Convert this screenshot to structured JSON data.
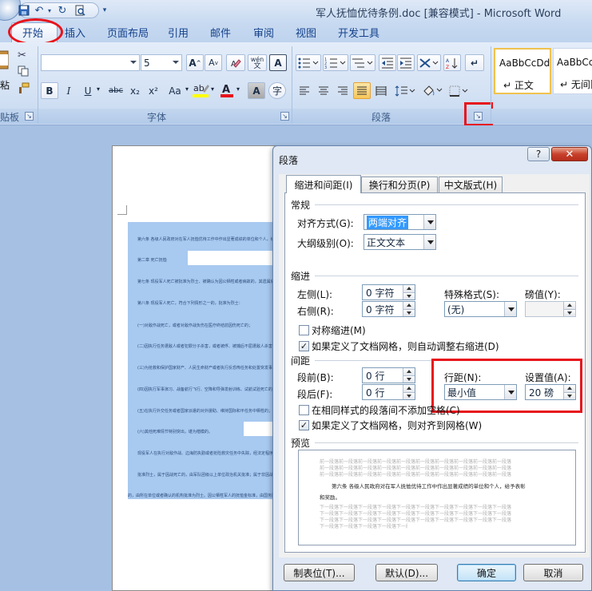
{
  "window": {
    "title": "军人抚恤优待条例.doc [兼容模式] - Microsoft Word"
  },
  "ribbon_tabs": [
    "开始",
    "插入",
    "页面布局",
    "引用",
    "邮件",
    "审阅",
    "视图",
    "开发工具"
  ],
  "ribbon": {
    "clipboard": {
      "label": "贴板",
      "paste_partial": "粘"
    },
    "font": {
      "label": "字体",
      "font_name": "",
      "font_size": "5",
      "buttons": {
        "bold": "B",
        "italic": "I",
        "underline": "U",
        "strike": "abc",
        "subscript": "x₂",
        "superscript": "x²",
        "change_case": "Aa",
        "grow": "A",
        "shrink": "A",
        "phonetic": "wén",
        "char_border": "A",
        "char_shade": "A",
        "enclose": "字"
      }
    },
    "paragraph": {
      "label": "段落"
    },
    "styles": {
      "style1": {
        "sample": "AaBbCcDd",
        "name": "↵ 正文"
      },
      "style2": {
        "sample": "AaBbCc",
        "name": "↵ 无间隔"
      }
    }
  },
  "document": {
    "lines": [
      "第六条  各级人民政府对在军人抚恤优待工作中作出显著成绩的单位和个人，给予表彰和奖励。",
      "第二章  死亡抚恤",
      "第七条  现役军人死亡被批准为烈士、被确认为因公牺牲或者病故的，其遗属依照本条例的规定享受抚恤。",
      "第八条  现役军人死亡，符合下列情形之一的，批准为烈士：",
      "(一)对敌作战死亡，或者对敌作战负伤在医疗终结前因伤死亡的；",
      "(二)因执行任务遭敌人或者犯罪分子杀害，或者被俘、被捕后不屈遭敌人杀害或者被折磨致死的；",
      "(三)为抢救和保护国家财产、人民生命财产或者执行反恐怖任务和处置突发事件死亡的；",
      "(四)因执行军事演习、战备航行飞行、空降和导弹发射训练、试航试验死亡的；",
      "(五)在执行外交任务或者国家派遣的对外援助、维持国际和平任务中牺牲的；",
      "(六)其他死难情节特别突出，堪为楷模的。",
      "现役军人在执行对敌作战、边海防执勤或者抢险救灾任务中失踪，经法定程序宣告死亡的，按照烈士对待。",
      "批准烈士，属于因战死亡的，由军队团级以上单位政治机关批准；属于非因战死亡的，由军队军级以上单位政治机关批准。",
      "的，由所在单位或者确认的机构批准为烈士。因公牺牲军人的抚恤金标准，由国务院民政部门会同国务院财政部门规定。"
    ]
  },
  "dialog": {
    "title": "段落",
    "help": "?",
    "close": "✕",
    "tabs": [
      "缩进和间距(I)",
      "换行和分页(P)",
      "中文版式(H)"
    ],
    "general": {
      "title": "常规",
      "alignment_label": "对齐方式(G):",
      "alignment_value": "两端对齐",
      "outline_label": "大纲级别(O):",
      "outline_value": "正文文本"
    },
    "indent": {
      "title": "缩进",
      "left_label": "左侧(L):",
      "left_value": "0 字符",
      "right_label": "右侧(R):",
      "right_value": "0 字符",
      "special_label": "特殊格式(S):",
      "special_value": "(无)",
      "by_label": "磅值(Y):",
      "by_value": "",
      "mirror_label": "对称缩进(M)",
      "mirror_checked": false,
      "auto_right_label": "如果定义了文档网格，则自动调整右缩进(D)",
      "auto_right_checked": true
    },
    "spacing": {
      "title": "间距",
      "before_label": "段前(B):",
      "before_value": "0 行",
      "after_label": "段后(F):",
      "after_value": "0 行",
      "line_spacing_label": "行距(N):",
      "line_spacing_value": "最小值",
      "at_label": "设置值(A):",
      "at_value": "20 磅",
      "no_space_label": "在相同样式的段落间不添加空格(C)",
      "no_space_checked": false,
      "snap_grid_label": "如果定义了文档网格，则对齐到网格(W)",
      "snap_grid_checked": true
    },
    "preview": {
      "title": "预览",
      "prev_text": "前一段落前一段落前一段落前一段落前一段落前一段落前一段落前一段落前一段落前一段落",
      "sample_line1": "第六条  各级人民政府对在军人抚恤优待工作中作出显著成绩的单位和个人，给予表彰",
      "sample_line2": "和奖励。",
      "next_text": "下一段落下一段落下一段落下一段落下一段落下一段落下一段落下一段落下一段落下一段落"
    },
    "buttons": {
      "tabs": "制表位(T)...",
      "default": "默认(D)...",
      "ok": "确定",
      "cancel": "取消"
    }
  },
  "colors": {
    "highlight_red": "#e8141c",
    "selection_blue": "#a8c9f0",
    "ribbon_text": "#15428b"
  }
}
